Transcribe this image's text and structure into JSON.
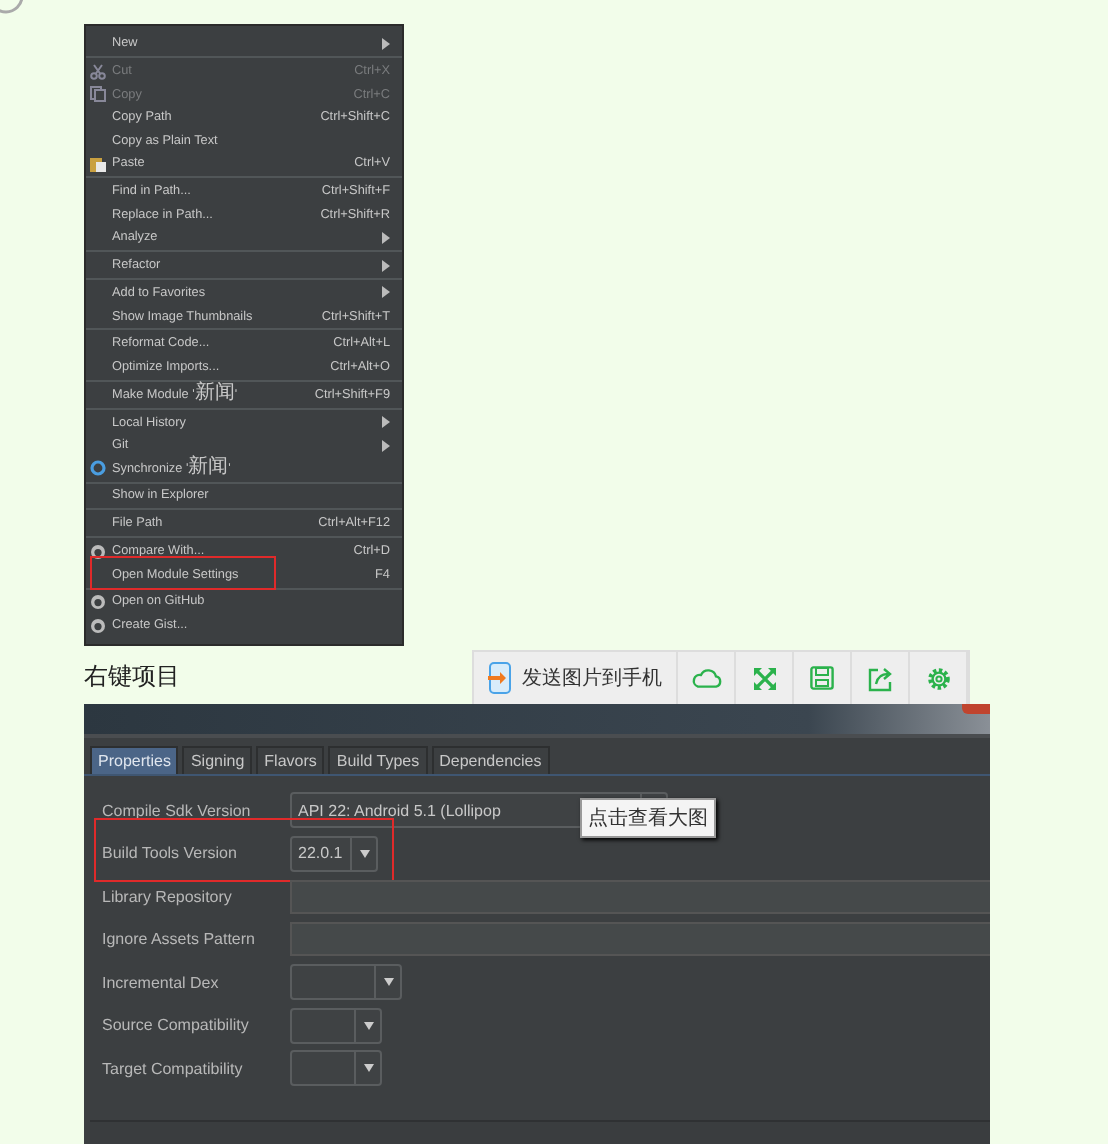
{
  "menu": {
    "items": [
      {
        "label": "New",
        "submenu": true,
        "separator_after": true
      },
      {
        "label": "Cut",
        "shortcut": "Ctrl+X",
        "disabled": true
      },
      {
        "label": "Copy",
        "shortcut": "Ctrl+C",
        "disabled": true
      },
      {
        "label": "Copy Path",
        "shortcut": "Ctrl+Shift+C"
      },
      {
        "label": "Copy as Plain Text"
      },
      {
        "label": "Paste",
        "shortcut": "Ctrl+V",
        "separator_after": true
      },
      {
        "label": "Find in Path...",
        "shortcut": "Ctrl+Shift+F"
      },
      {
        "label": "Replace in Path...",
        "shortcut": "Ctrl+Shift+R"
      },
      {
        "label": "Analyze",
        "submenu": true,
        "separator_after": true
      },
      {
        "label": "Refactor",
        "submenu": true,
        "separator_after": true
      },
      {
        "label": "Add to Favorites",
        "submenu": true
      },
      {
        "label": "Show Image Thumbnails",
        "shortcut": "Ctrl+Shift+T",
        "separator_after": true
      },
      {
        "label": "Reformat Code...",
        "shortcut": "Ctrl+Alt+L"
      },
      {
        "label": "Optimize Imports...",
        "shortcut": "Ctrl+Alt+O",
        "separator_after": true
      },
      {
        "label": "Make Module '新闻'",
        "shortcut": "Ctrl+Shift+F9",
        "separator_after": true
      },
      {
        "label": "Local History",
        "submenu": true
      },
      {
        "label": "Git",
        "submenu": true
      },
      {
        "label": "Synchronize '新闻'",
        "separator_after": true
      },
      {
        "label": "Show in Explorer",
        "separator_after": true
      },
      {
        "label": "File Path",
        "shortcut": "Ctrl+Alt+F12",
        "separator_after": true
      },
      {
        "label": "Compare With...",
        "shortcut": "Ctrl+D"
      },
      {
        "label": "Open Module Settings",
        "shortcut": "F4",
        "highlighted": true,
        "separator_after": true
      },
      {
        "label": "Open on GitHub"
      },
      {
        "label": "Create Gist..."
      }
    ]
  },
  "caption": "右键项目",
  "toolbar": {
    "send_button": "发送图片到手机"
  },
  "dialog": {
    "tabs": [
      {
        "label": "Properties",
        "selected": true
      },
      {
        "label": "Signing",
        "selected": false
      },
      {
        "label": "Flavors",
        "selected": false
      },
      {
        "label": "Build Types",
        "selected": false
      },
      {
        "label": "Dependencies",
        "selected": false
      }
    ],
    "fields": [
      {
        "label": "Compile Sdk Version",
        "kind": "dropdown",
        "value": "API 22: Android 5.1 (Lollipop"
      },
      {
        "label": "Build Tools Version",
        "kind": "dropdown",
        "value": "22.0.1",
        "highlighted": true
      },
      {
        "label": "Library Repository",
        "kind": "text"
      },
      {
        "label": "Ignore Assets Pattern",
        "kind": "text"
      },
      {
        "label": "Incremental Dex",
        "kind": "dropdown"
      },
      {
        "label": "Source Compatibility",
        "kind": "small-dropdown"
      },
      {
        "label": "Target Compatibility",
        "kind": "small-dropdown"
      }
    ]
  },
  "tooltip": "点击查看大图"
}
